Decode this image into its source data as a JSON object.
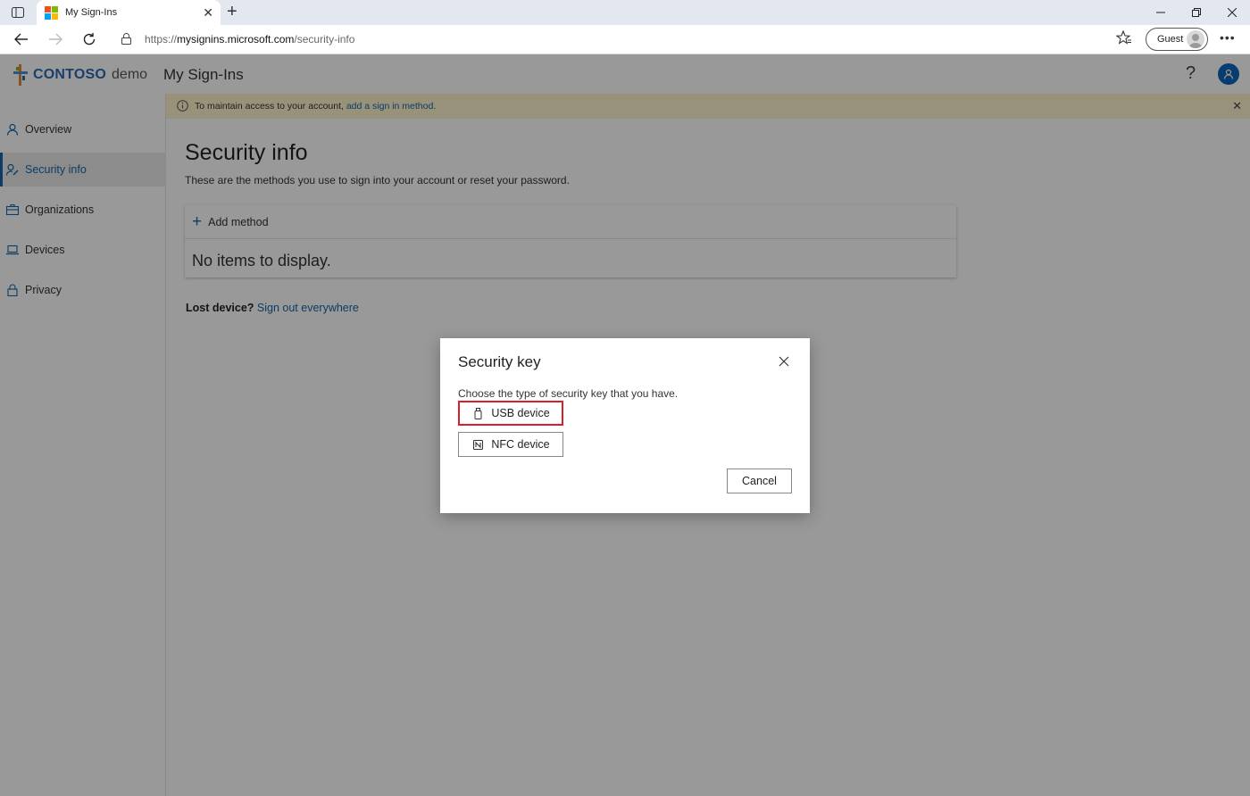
{
  "browser": {
    "tab_title": "My Sign-Ins",
    "url_prefix": "https://",
    "url_host": "mysignins.microsoft.com",
    "url_path": "/security-info",
    "profile_label": "Guest"
  },
  "app": {
    "logo_text": "CONTOSO",
    "logo_suffix": "demo",
    "title": "My Sign-Ins",
    "help_label": "?"
  },
  "sidebar": {
    "items": [
      {
        "label": "Overview",
        "icon": "person-icon"
      },
      {
        "label": "Security info",
        "icon": "security-info-icon",
        "active": true
      },
      {
        "label": "Organizations",
        "icon": "briefcase-icon"
      },
      {
        "label": "Devices",
        "icon": "laptop-icon"
      },
      {
        "label": "Privacy",
        "icon": "lock-icon"
      }
    ]
  },
  "banner": {
    "text": "To maintain access to your account,",
    "link": "add a sign in method."
  },
  "main": {
    "title": "Security info",
    "subtitle": "These are the methods you use to sign into your account or reset your password.",
    "add_method": "Add method",
    "empty_text": "No items to display.",
    "lost_device_label": "Lost device?",
    "sign_out_link": "Sign out everywhere"
  },
  "dialog": {
    "title": "Security key",
    "description": "Choose the type of security key that you have.",
    "options": [
      {
        "label": "USB device",
        "icon": "usb-icon",
        "highlighted": true
      },
      {
        "label": "NFC device",
        "icon": "nfc-icon"
      }
    ],
    "cancel_label": "Cancel"
  },
  "colors": {
    "accent": "#1565a8",
    "banner_bg": "#fff4ce",
    "highlight": "#d9202f"
  }
}
